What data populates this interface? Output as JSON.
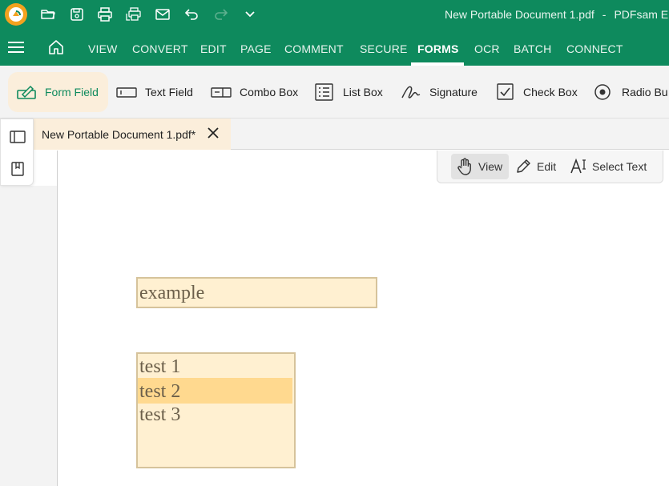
{
  "colors": {
    "brand": "#0e8a5d",
    "ribbon_bg": "#f3f3f3",
    "active_tab_bg": "#fbeedb",
    "field_bg": "#fff0d1",
    "field_border": "#d6c39b",
    "selected_option": "#ffd98f"
  },
  "titlebar": {
    "logo_icon": "pdfsam-logo-icon",
    "quick_access": [
      "open-folder-icon",
      "save-icon",
      "print-icon",
      "batch-print-icon",
      "mail-icon",
      "undo-icon",
      "redo-icon",
      "chevron-down-icon"
    ],
    "document": "New Portable Document 1.pdf",
    "separator": "-",
    "app_name": "PDFsam Er"
  },
  "menubar": {
    "items": [
      "VIEW",
      "CONVERT",
      "EDIT",
      "PAGE",
      "COMMENT",
      "SECURE",
      "FORMS",
      "OCR",
      "BATCH",
      "CONNECT"
    ],
    "active": "FORMS"
  },
  "ribbon": {
    "items": [
      {
        "label": "Form Field",
        "icon": "form-field-icon",
        "active": true
      },
      {
        "label": "Text Field",
        "icon": "text-field-icon"
      },
      {
        "label": "Combo Box",
        "icon": "combo-box-icon"
      },
      {
        "label": "List Box",
        "icon": "list-box-icon"
      },
      {
        "label": "Signature",
        "icon": "signature-icon"
      },
      {
        "label": "Check Box",
        "icon": "check-box-icon"
      },
      {
        "label": "Radio Bu",
        "icon": "radio-button-icon"
      }
    ]
  },
  "tabs": {
    "document_tab": "New Portable Document 1.pdf*"
  },
  "viewbar": {
    "view": "View",
    "edit": "Edit",
    "select_text": "Select Text"
  },
  "page": {
    "text_field_value": "example",
    "list_box": {
      "options": [
        "test 1",
        "test 2",
        "test 3"
      ],
      "selected": "test 2"
    }
  }
}
